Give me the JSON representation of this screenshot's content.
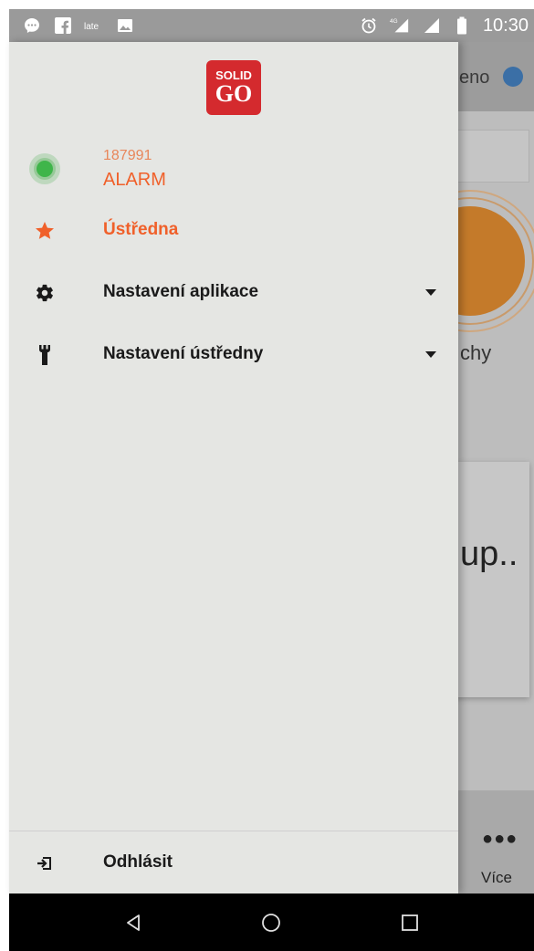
{
  "status_bar": {
    "time": "10:30",
    "left_icons": [
      "messenger-icon",
      "facebook-icon",
      "app-icon",
      "image-icon"
    ],
    "right_icons": [
      "alarm-clock-icon",
      "4g-signal-icon",
      "signal-icon",
      "battery-icon"
    ]
  },
  "background_app": {
    "status_text": "eno",
    "card_label": "chy",
    "loading_text": "up..",
    "more_label": "Více"
  },
  "drawer": {
    "logo": {
      "top": "SOLID",
      "bottom": "GO"
    },
    "account": {
      "id": "187991",
      "name": "ALARM"
    },
    "items": [
      {
        "label": "Ústředna",
        "icon": "star-icon",
        "active": true
      },
      {
        "label": "Nastavení aplikace",
        "icon": "gear-icon",
        "expandable": true
      },
      {
        "label": "Nastavení ústředny",
        "icon": "wrench-icon",
        "expandable": true
      }
    ],
    "logout": {
      "label": "Odhlásit",
      "icon": "logout-icon"
    }
  },
  "navigation": [
    "back-icon",
    "home-icon",
    "recents-icon"
  ],
  "colors": {
    "accent": "#f0602a",
    "online": "#3fb54a",
    "logo": "#d42a2e"
  }
}
